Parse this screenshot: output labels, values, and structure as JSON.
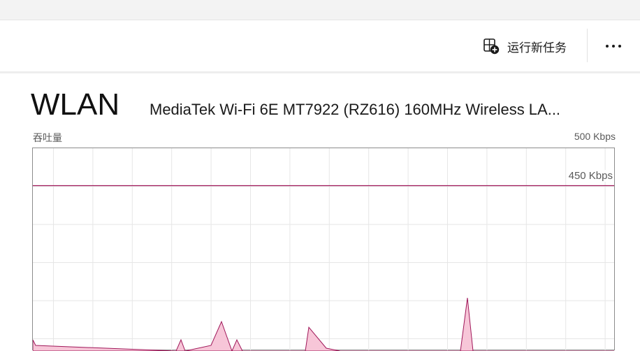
{
  "toolbar": {
    "run_task_label": "运行新任务",
    "run_task_icon": "run-new-task-icon",
    "more_icon": "more-options-icon"
  },
  "adapter": {
    "title": "WLAN",
    "description": "MediaTek Wi-Fi 6E MT7922 (RZ616) 160MHz Wireless LA..."
  },
  "graph": {
    "label": "吞吐量",
    "max_label": "500 Kbps",
    "scale_line_label": "450 Kbps",
    "line_color": "#a0185a",
    "fill_color": "#f7c6d8"
  }
}
